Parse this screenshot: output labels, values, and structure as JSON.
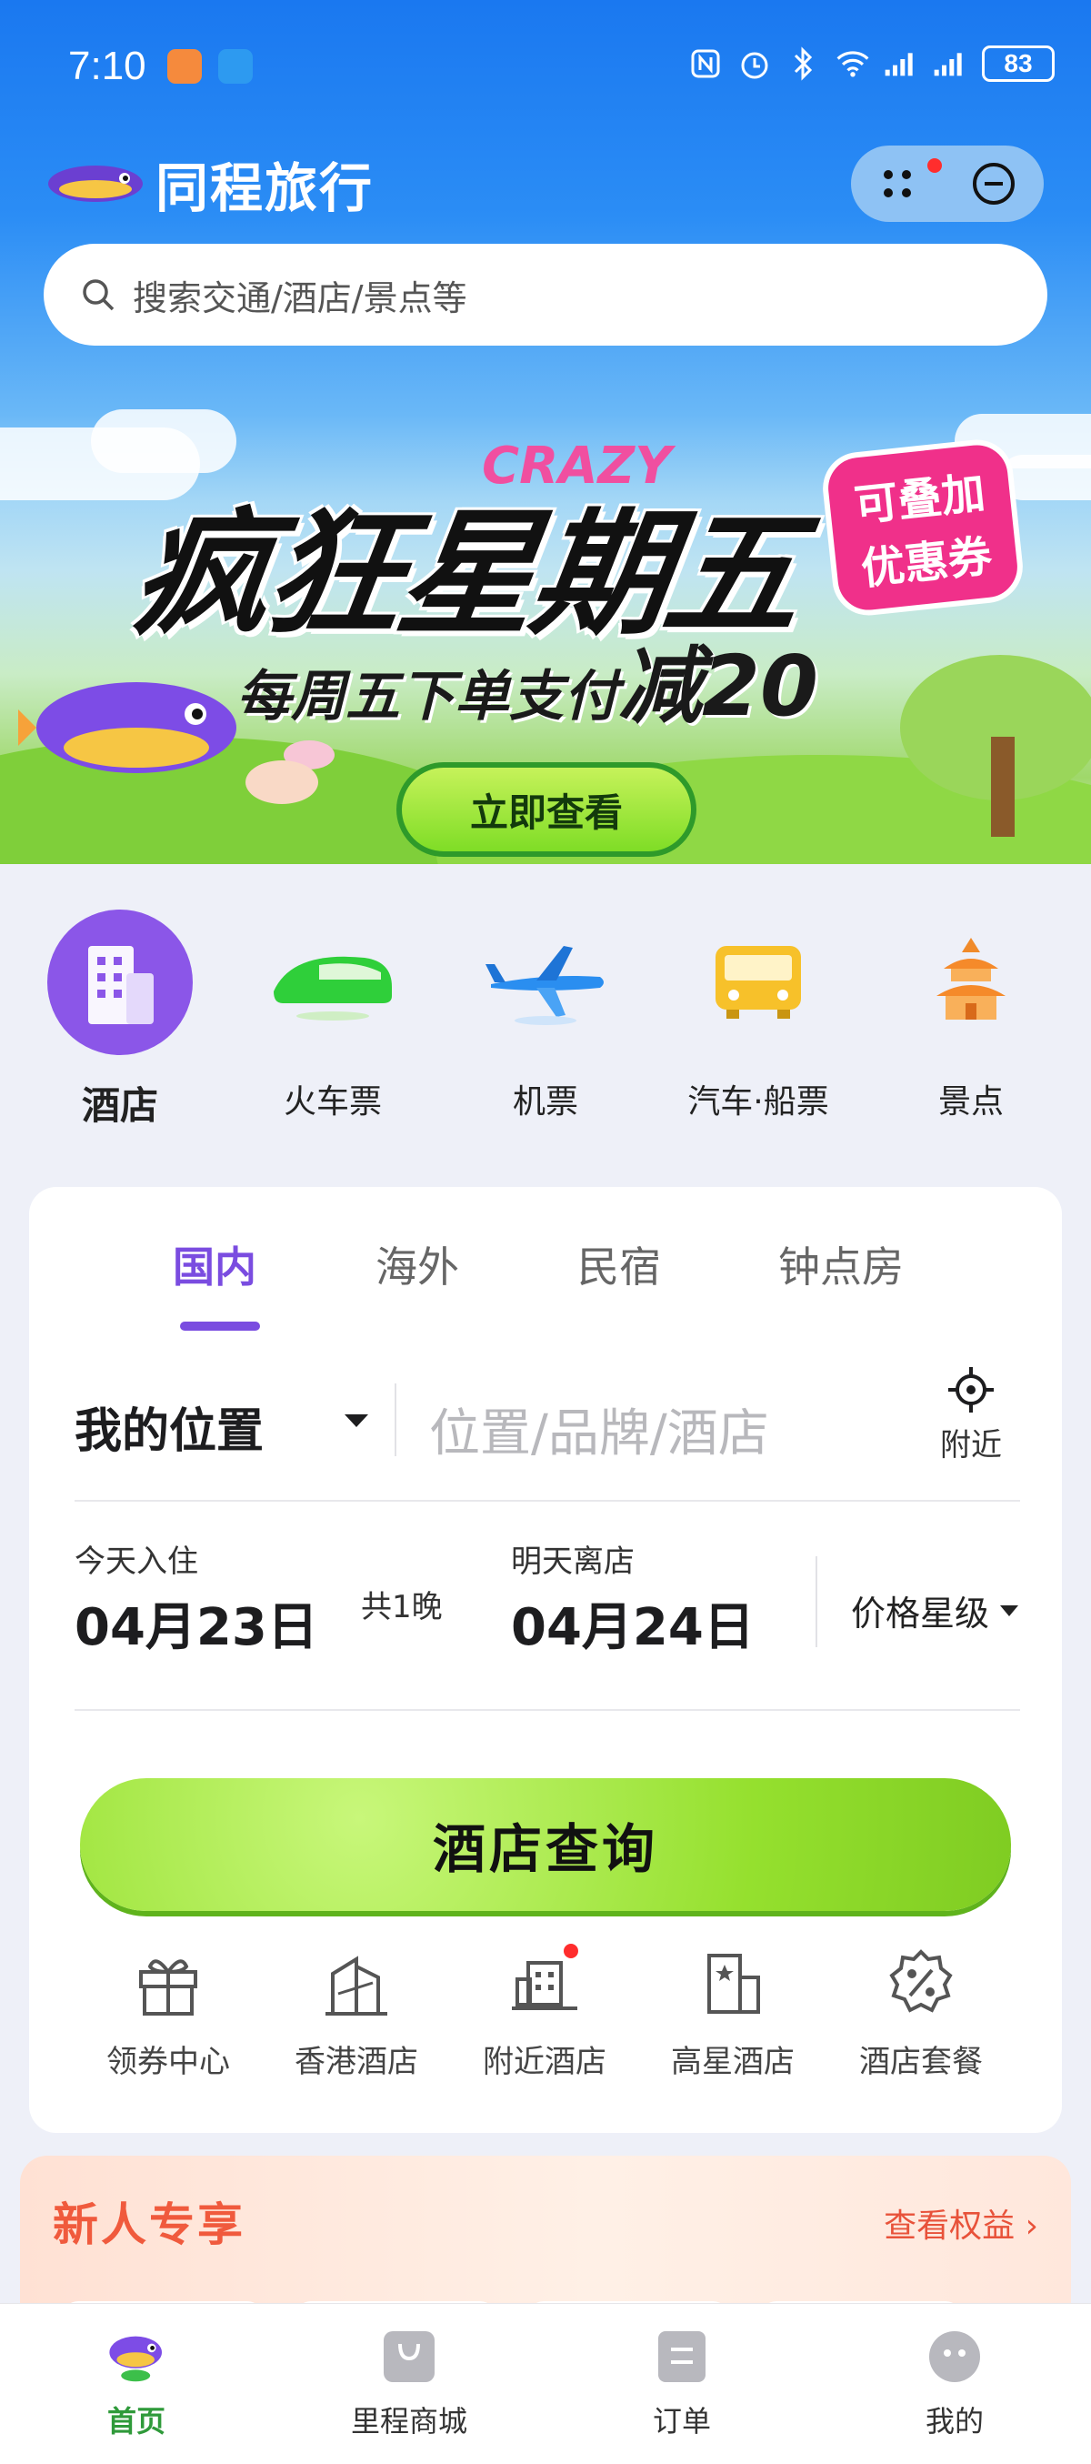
{
  "status_bar": {
    "time": "7:10",
    "battery": "83"
  },
  "header": {
    "app_name": "同程旅行",
    "search_placeholder": "搜索交通/酒店/景点等"
  },
  "banner": {
    "crazy": "CRAZY",
    "title": "疯狂星期五",
    "subtitle_prefix": "每周五下单支付",
    "subtitle_strong": "减20",
    "stack_line1": "可叠加",
    "stack_line2": "优惠券",
    "cta": "立即查看"
  },
  "categories": [
    {
      "label": "酒店",
      "icon": "hotel-icon"
    },
    {
      "label": "火车票",
      "icon": "train-icon"
    },
    {
      "label": "机票",
      "icon": "plane-icon"
    },
    {
      "label": "汽车·船票",
      "icon": "bus-icon"
    },
    {
      "label": "景点",
      "icon": "temple-icon"
    }
  ],
  "booking": {
    "tabs": [
      "国内",
      "海外",
      "民宿",
      "钟点房"
    ],
    "location_label": "我的位置",
    "location_placeholder": "位置/品牌/酒店",
    "nearby": "附近",
    "checkin_label": "今天入住",
    "checkin_date": "04月23日",
    "nights": "共1晚",
    "checkout_label": "明天离店",
    "checkout_date": "04月24日",
    "price_star": "价格星级",
    "search_button": "酒店查询"
  },
  "shortcuts": [
    {
      "label": "领券中心",
      "icon": "gift-icon"
    },
    {
      "label": "香港酒店",
      "icon": "hk-building-icon"
    },
    {
      "label": "附近酒店",
      "icon": "nearby-hotel-icon"
    },
    {
      "label": "高星酒店",
      "icon": "star-building-icon"
    },
    {
      "label": "酒店套餐",
      "icon": "discount-badge-icon"
    }
  ],
  "new_user": {
    "title": "新人专享",
    "link": "查看权益"
  },
  "tabbar": [
    {
      "label": "首页",
      "icon": "home-mascot-icon"
    },
    {
      "label": "里程商城",
      "icon": "shopping-bag-icon"
    },
    {
      "label": "订单",
      "icon": "order-icon"
    },
    {
      "label": "我的",
      "icon": "profile-icon"
    }
  ],
  "colors": {
    "accent_purple": "#7a4ce0",
    "cta_green": "#95e02e",
    "header_blue": "#1a78f0",
    "new_user_red": "#f05a3d",
    "tab_active_green": "#2f9a3a"
  }
}
